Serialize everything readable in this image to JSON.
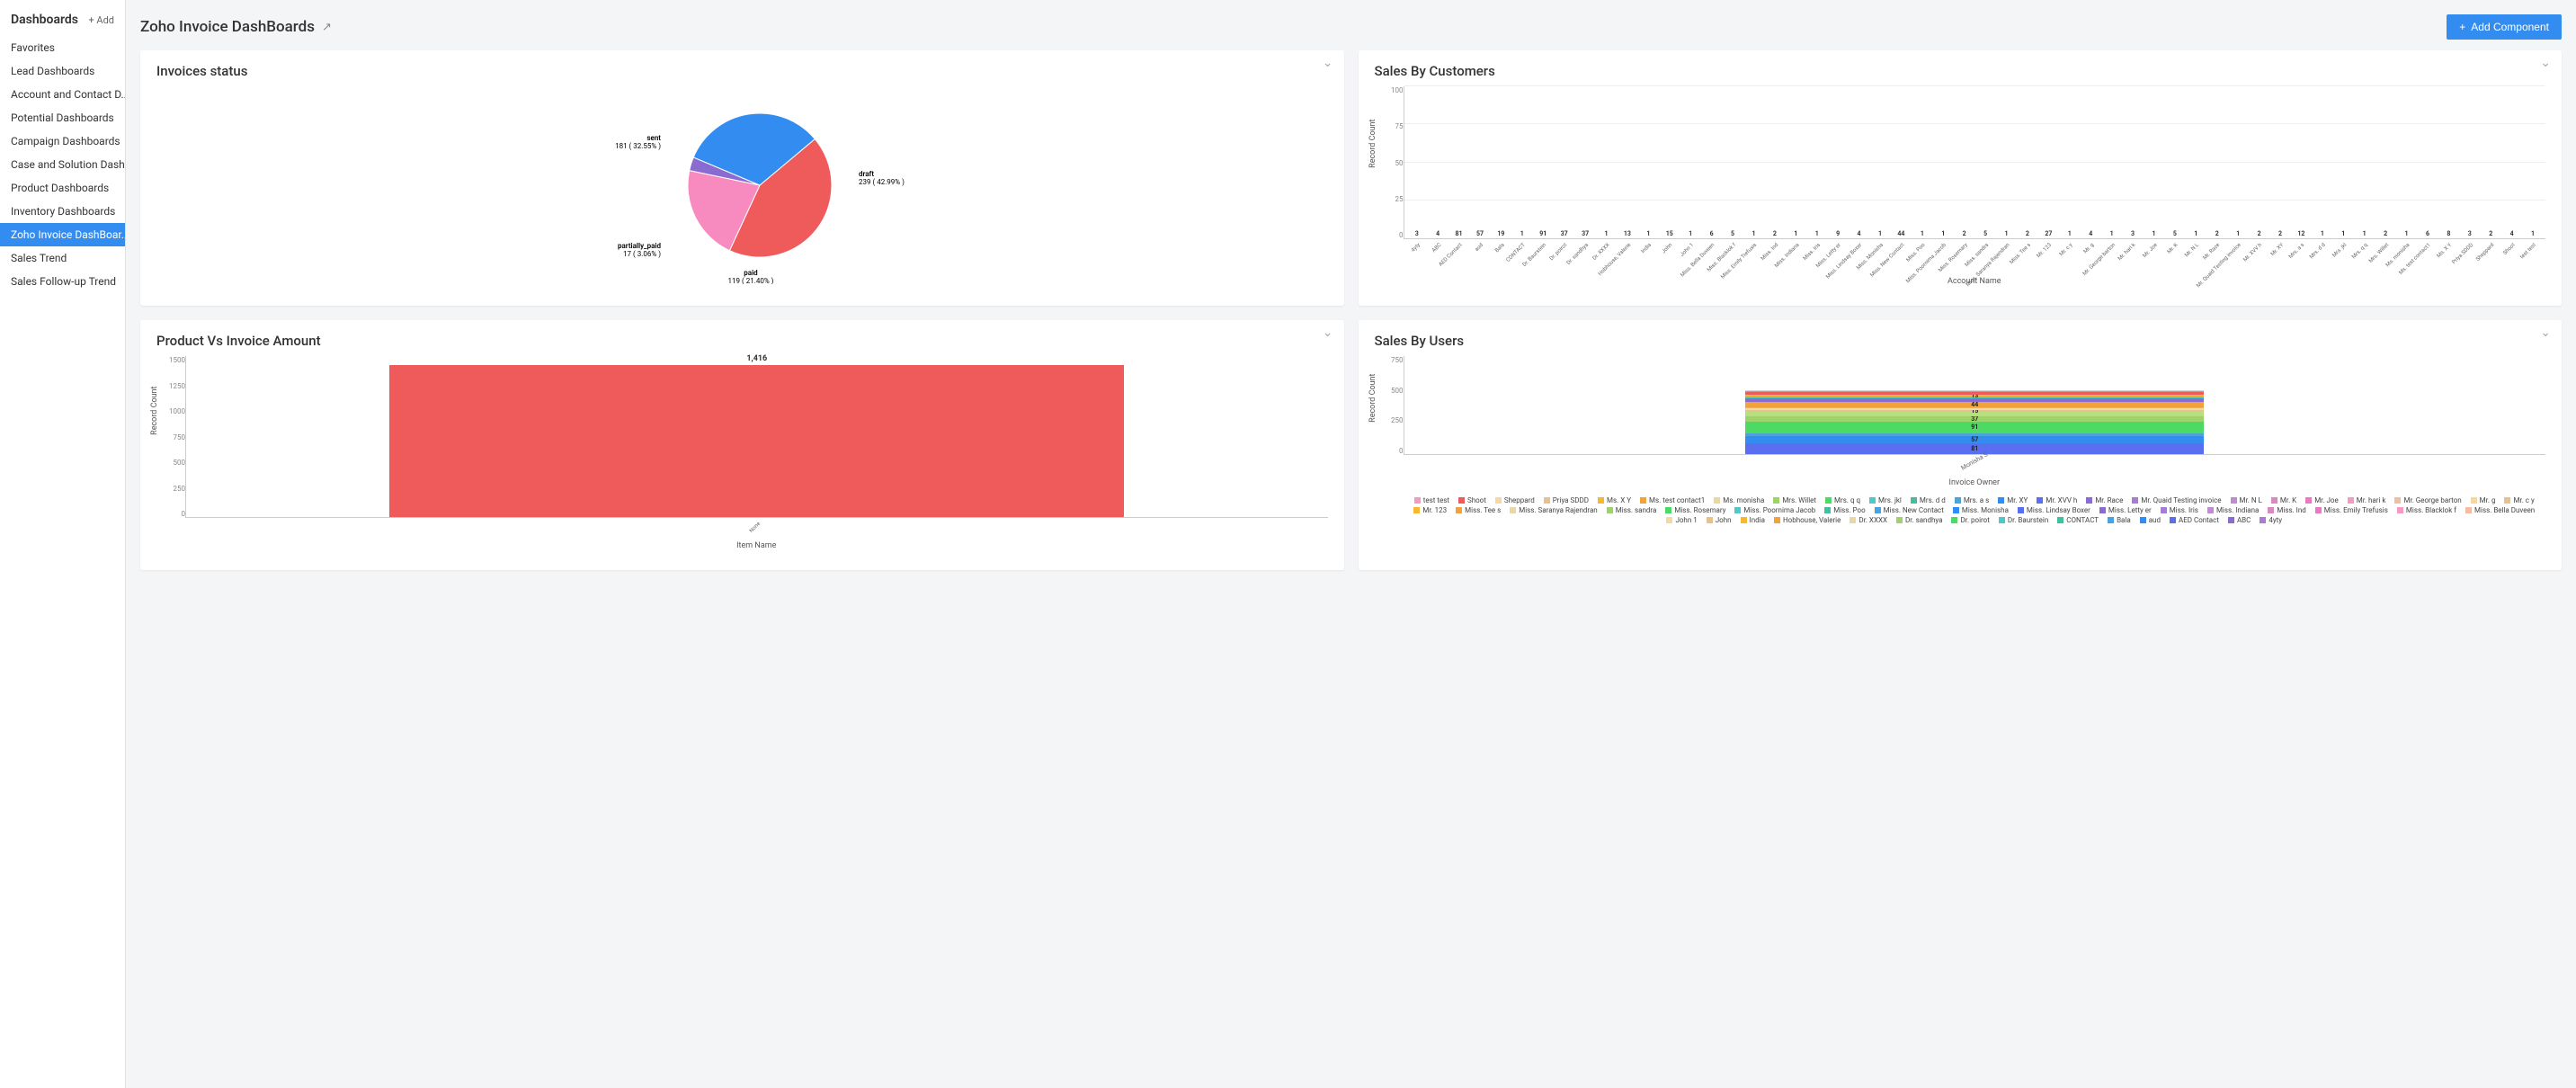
{
  "sidebar": {
    "title": "Dashboards",
    "add_label": "+ Add",
    "items": [
      {
        "label": "Favorites",
        "active": false
      },
      {
        "label": "Lead Dashboards",
        "active": false
      },
      {
        "label": "Account and Contact D...",
        "active": false
      },
      {
        "label": "Potential Dashboards",
        "active": false
      },
      {
        "label": "Campaign Dashboards",
        "active": false
      },
      {
        "label": "Case and Solution Dash...",
        "active": false
      },
      {
        "label": "Product Dashboards",
        "active": false
      },
      {
        "label": "Inventory Dashboards",
        "active": false
      },
      {
        "label": "Zoho Invoice DashBoar...",
        "active": true
      },
      {
        "label": "Sales Trend",
        "active": false
      },
      {
        "label": "Sales Follow-up Trend",
        "active": false
      }
    ]
  },
  "header": {
    "title": "Zoho Invoice DashBoards",
    "add_component_label": "Add Component"
  },
  "cards": {
    "invoices_status": {
      "title": "Invoices status"
    },
    "sales_by_customers": {
      "title": "Sales By Customers",
      "ylabel": "Record Count",
      "xlabel": "Account Name"
    },
    "product_vs_invoice": {
      "title": "Product Vs Invoice Amount",
      "ylabel": "Record Count",
      "xlabel": "Item Name"
    },
    "sales_by_users": {
      "title": "Sales By Users",
      "ylabel": "Record Count",
      "xlabel": "Invoice Owner"
    }
  },
  "chart_data": [
    {
      "id": "invoices_status",
      "type": "pie",
      "title": "Invoices status",
      "series": [
        {
          "name": "draft",
          "value": 239,
          "pct": 42.99,
          "color": "#ef5b5b"
        },
        {
          "name": "paid",
          "value": 119,
          "pct": 21.4,
          "color": "#f78bc0"
        },
        {
          "name": "partially_paid",
          "value": 17,
          "pct": 3.06,
          "color": "#8a6bd1"
        },
        {
          "name": "sent",
          "value": 181,
          "pct": 32.55,
          "color": "#338cf0"
        }
      ]
    },
    {
      "id": "sales_by_customers",
      "type": "bar",
      "title": "Sales By Customers",
      "ylabel": "Record Count",
      "xlabel": "Account Name",
      "ylim": [
        0,
        100
      ],
      "yticks": [
        0,
        25,
        50,
        75,
        100
      ],
      "categories": [
        "4yty",
        "ABC",
        "AED Contact",
        "aud",
        "Bala",
        "CONTACT",
        "Dr. Baurstein",
        "Dr. poirot",
        "Dr. sandhya",
        "Dr. XXXX",
        "Hobhouse, Valerie",
        "India",
        "John",
        "John 1",
        "Miss. Bella Duveen",
        "Miss. Blacklok f",
        "Miss. Emily Trefusis",
        "Miss. Ind",
        "Miss. Indiana",
        "Miss. Iris",
        "Miss. Letty er",
        "Miss. Lindsay Boxer",
        "Miss. Monisha",
        "Miss. New Contact",
        "Miss. Poo",
        "Miss. Poornima Jacob",
        "Miss. Rosemary",
        "Miss. sandra",
        "Miss. Saranya Rajendran",
        "Miss. Tee s",
        "Mr. 123",
        "Mr. c y",
        "Mr. g",
        "Mr. George barton",
        "Mr. hari k",
        "Mr. Joe",
        "Mr. K",
        "Mr. N L",
        "Mr. Race",
        "Mr. Quaid Testing invoice",
        "Mr. XVV h",
        "Mr. XY",
        "Mrs. a s",
        "Mrs. d d",
        "Mrs. jkl",
        "Mrs. q q",
        "Mrs. Willet",
        "Ms. monisha",
        "Ms. test contact1",
        "Ms. X Y",
        "Priya SDDD",
        "Sheppard",
        "Shoot",
        "test test"
      ],
      "values": [
        3,
        4,
        81,
        57,
        19,
        1,
        91,
        37,
        37,
        1,
        13,
        1,
        15,
        1,
        6,
        5,
        1,
        2,
        1,
        1,
        9,
        4,
        1,
        44,
        1,
        1,
        2,
        5,
        1,
        2,
        27,
        1,
        4,
        1,
        3,
        1,
        5,
        1,
        2,
        1,
        2,
        2,
        12,
        1,
        1,
        1,
        2,
        1,
        6,
        8,
        3,
        2,
        4,
        1,
        2
      ],
      "colors": [
        "#f79ac1",
        "#f7b731",
        "#4aa3df",
        "#338cf0",
        "#ffd454",
        "#d0d0d0",
        "#4cd964",
        "#9ed36a",
        "#b6e07f",
        "#bbb",
        "#f2a23a",
        "#e879c3",
        "#5a87f0",
        "#d0d0d0",
        "#e879c3",
        "#f7b731",
        "#d0d0d0",
        "#d0d0d0",
        "#d0d0d0",
        "#9ed36a",
        "#4cd964",
        "#b6e07f",
        "#e879c3",
        "#f2a23a",
        "#d0d0d0",
        "#d0d0d0",
        "#e879c3",
        "#ef5b5b",
        "#d0d0d0",
        "#d0d0d0",
        "#8a6bd1",
        "#d0d0d0",
        "#d0d0d0",
        "#d0d0d0",
        "#d0d0d0",
        "#d0d0d0",
        "#e879c3",
        "#d0d0d0",
        "#d0d0d0",
        "#d0d0d0",
        "#d0d0d0",
        "#d0d0d0",
        "#51c8c8",
        "#d0d0d0",
        "#d0d0d0",
        "#d0d0d0",
        "#d0d0d0",
        "#d0d0d0",
        "#e879c3",
        "#f7b731",
        "#9ed36a",
        "#e879c3",
        "#4cd964",
        "#d0d0d0",
        "#d0d0d0"
      ]
    },
    {
      "id": "product_vs_invoice",
      "type": "bar",
      "title": "Product Vs Invoice Amount",
      "ylabel": "Record Count",
      "xlabel": "Item Name",
      "ylim": [
        0,
        1500
      ],
      "yticks": [
        0,
        250,
        500,
        750,
        1000,
        1250,
        1500
      ],
      "categories": [
        "None"
      ],
      "values": [
        1416
      ],
      "colors": [
        "#ef5b5b"
      ]
    },
    {
      "id": "sales_by_users",
      "type": "stacked_bar",
      "title": "Sales By Users",
      "ylabel": "Record Count",
      "xlabel": "Invoice Owner",
      "ylim": [
        0,
        750
      ],
      "yticks": [
        0,
        250,
        500,
        750
      ],
      "categories": [
        "Monisha S"
      ],
      "visible_segment_labels": [
        81,
        57,
        91,
        37,
        15,
        44,
        13
      ],
      "legend": [
        {
          "name": "test test",
          "color": "#f79ac1"
        },
        {
          "name": "Shoot",
          "color": "#ef5b5b"
        },
        {
          "name": "Sheppard",
          "color": "#f6d8a0"
        },
        {
          "name": "Priya SDDD",
          "color": "#e6c38c"
        },
        {
          "name": "Ms. X Y",
          "color": "#f7b731"
        },
        {
          "name": "Ms. test contact1",
          "color": "#f2a23a"
        },
        {
          "name": "Ms. monisha",
          "color": "#e9d8a6"
        },
        {
          "name": "Mrs. Willet",
          "color": "#9ed36a"
        },
        {
          "name": "Mrs. q q",
          "color": "#4cd964"
        },
        {
          "name": "Mrs. jkl",
          "color": "#51c8c8"
        },
        {
          "name": "Mrs. d d",
          "color": "#40c0a0"
        },
        {
          "name": "Mrs. a s",
          "color": "#4aa3df"
        },
        {
          "name": "Mr. XY",
          "color": "#338cf0"
        },
        {
          "name": "Mr. XVV h",
          "color": "#5a6ff0"
        },
        {
          "name": "Mr. Race",
          "color": "#8a6bd1"
        },
        {
          "name": "Mr. Quaid Testing invoice",
          "color": "#a77bd9"
        },
        {
          "name": "Mr. N L",
          "color": "#c08ad4"
        },
        {
          "name": "Mr. K",
          "color": "#d88abf"
        },
        {
          "name": "Mr. Joe",
          "color": "#e879c3"
        },
        {
          "name": "Mr. hari k",
          "color": "#f79ac1"
        },
        {
          "name": "Mr. George barton",
          "color": "#f2bda3"
        },
        {
          "name": "Mr. g",
          "color": "#f6d8a0"
        },
        {
          "name": "Mr. c y",
          "color": "#e6c38c"
        },
        {
          "name": "Mr. 123",
          "color": "#f7b731"
        },
        {
          "name": "Miss. Tee s",
          "color": "#f2a23a"
        },
        {
          "name": "Miss. Saranya Rajendran",
          "color": "#e9d8a6"
        },
        {
          "name": "Miss. sandra",
          "color": "#9ed36a"
        },
        {
          "name": "Miss. Rosemary",
          "color": "#4cd964"
        },
        {
          "name": "Miss. Poornima Jacob",
          "color": "#51c8c8"
        },
        {
          "name": "Miss. Poo",
          "color": "#40c0a0"
        },
        {
          "name": "Miss. New Contact",
          "color": "#4aa3df"
        },
        {
          "name": "Miss. Monisha",
          "color": "#338cf0"
        },
        {
          "name": "Miss. Lindsay Boxer",
          "color": "#5a6ff0"
        },
        {
          "name": "Miss. Letty er",
          "color": "#8a6bd1"
        },
        {
          "name": "Miss. Iris",
          "color": "#a77bd9"
        },
        {
          "name": "Miss. Indiana",
          "color": "#c08ad4"
        },
        {
          "name": "Miss. Ind",
          "color": "#d88abf"
        },
        {
          "name": "Miss. Emily Trefusis",
          "color": "#e879c3"
        },
        {
          "name": "Miss. Blacklok f",
          "color": "#f79ac1"
        },
        {
          "name": "Miss. Bella Duveen",
          "color": "#f2bda3"
        },
        {
          "name": "John 1",
          "color": "#f6d8a0"
        },
        {
          "name": "John",
          "color": "#e6c38c"
        },
        {
          "name": "India",
          "color": "#f7b731"
        },
        {
          "name": "Hobhouse, Valerie",
          "color": "#f2a23a"
        },
        {
          "name": "Dr. XXXX",
          "color": "#e9d8a6"
        },
        {
          "name": "Dr. sandhya",
          "color": "#9ed36a"
        },
        {
          "name": "Dr. poirot",
          "color": "#4cd964"
        },
        {
          "name": "Dr. Baurstein",
          "color": "#51c8c8"
        },
        {
          "name": "CONTACT",
          "color": "#40c0a0"
        },
        {
          "name": "Bala",
          "color": "#4aa3df"
        },
        {
          "name": "aud",
          "color": "#338cf0"
        },
        {
          "name": "AED Contact",
          "color": "#5a6ff0"
        },
        {
          "name": "ABC",
          "color": "#8a6bd1"
        },
        {
          "name": "4yty",
          "color": "#a77bd9"
        }
      ],
      "stack_segments": [
        {
          "value": 81,
          "color": "#5a6ff0"
        },
        {
          "value": 57,
          "color": "#338cf0"
        },
        {
          "value": 20,
          "color": "#4aa3df"
        },
        {
          "value": 91,
          "color": "#4cd964"
        },
        {
          "value": 37,
          "color": "#9ed36a"
        },
        {
          "value": 37,
          "color": "#b6e07f"
        },
        {
          "value": 15,
          "color": "#e6c38c"
        },
        {
          "value": 10,
          "color": "#f6d8a0"
        },
        {
          "value": 10,
          "color": "#f79ac1"
        },
        {
          "value": 44,
          "color": "#f2a23a"
        },
        {
          "value": 27,
          "color": "#8a6bd1"
        },
        {
          "value": 12,
          "color": "#51c8c8"
        },
        {
          "value": 13,
          "color": "#f7b731"
        },
        {
          "value": 20,
          "color": "#ef5b5b"
        },
        {
          "value": 10,
          "color": "#e879c3"
        },
        {
          "value": 8,
          "color": "#d0d0d0"
        }
      ]
    }
  ]
}
